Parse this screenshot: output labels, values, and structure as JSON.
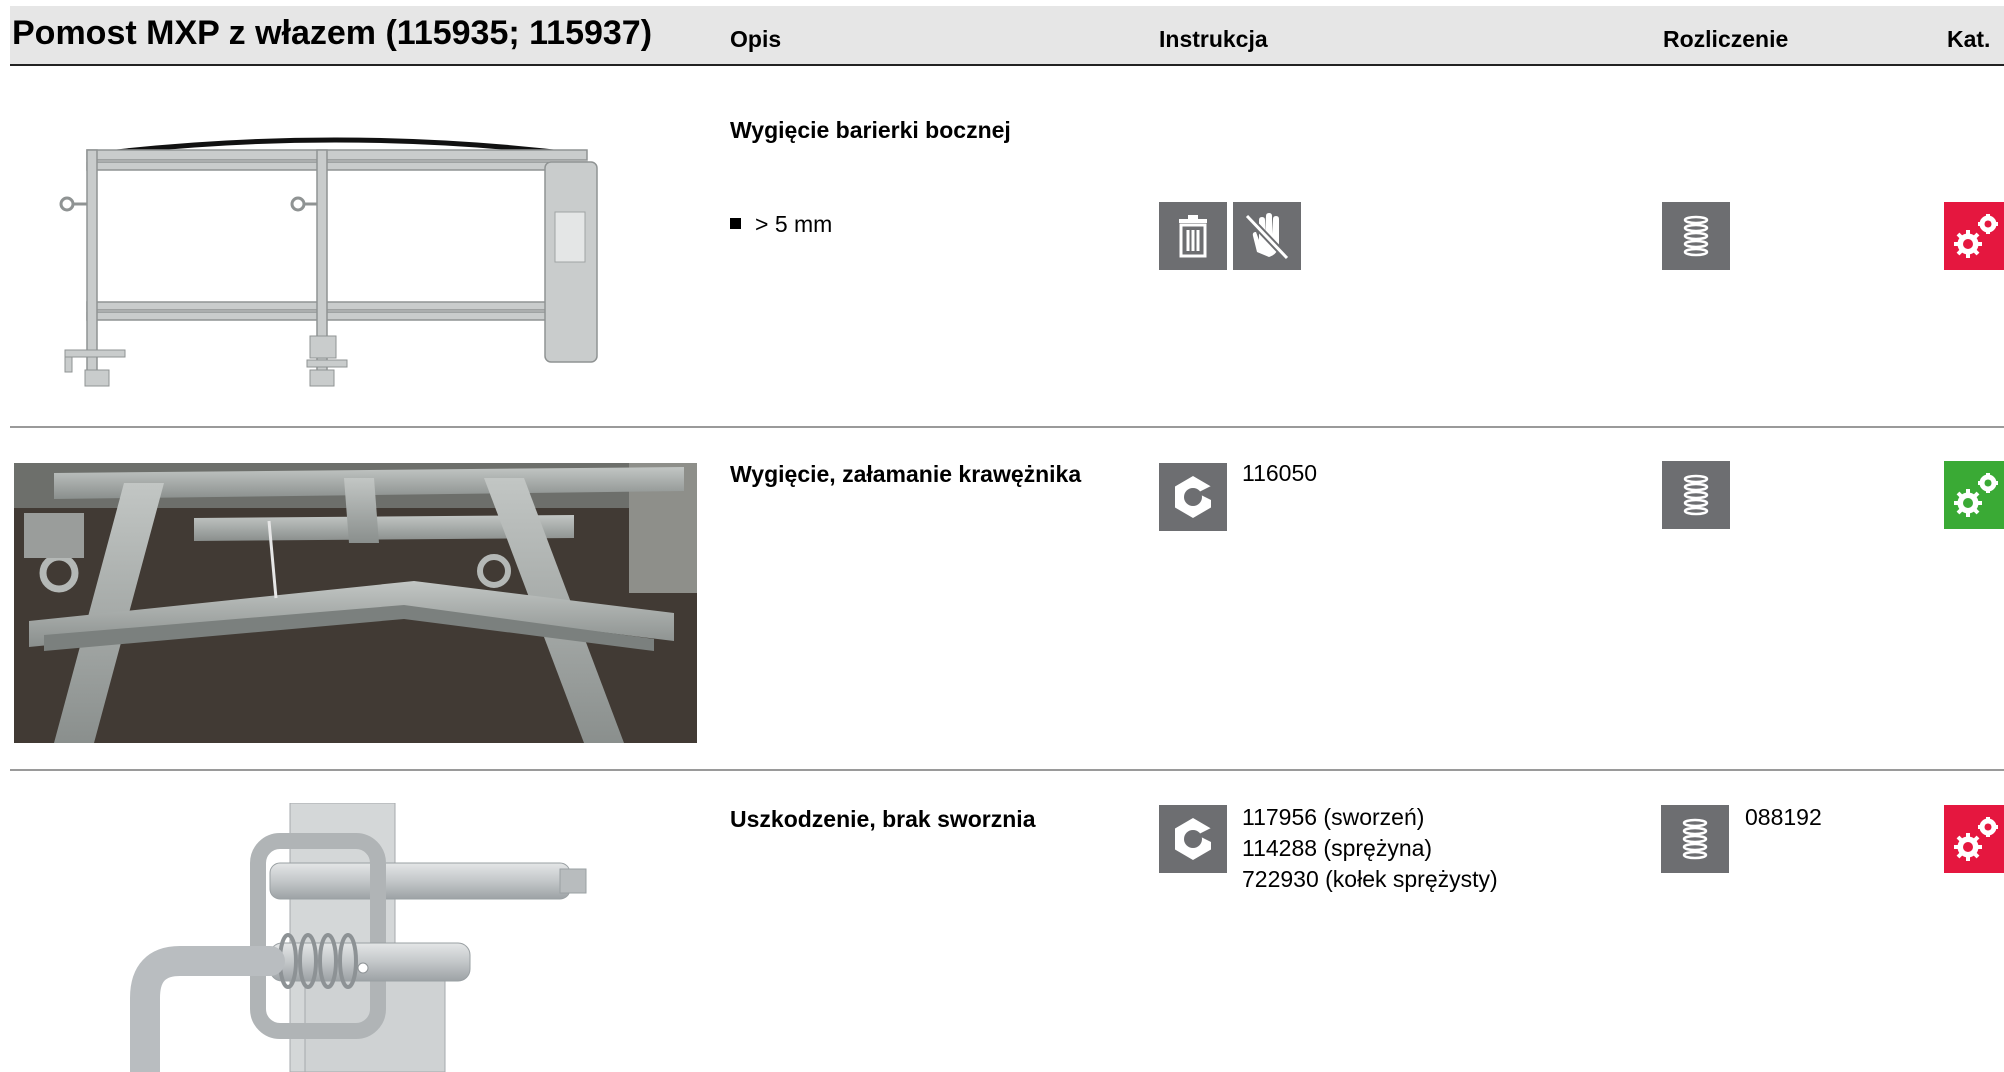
{
  "header": {
    "title": "Pomost MXP z włazem (115935; 115937)",
    "col_opis": "Opis",
    "col_instrukcja": "Instrukcja",
    "col_rozliczenie": "Rozliczenie",
    "col_kat": "Kat."
  },
  "rows": [
    {
      "description": "Wygięcie barierki bocznej",
      "bullet": "> 5 mm",
      "instruction_icons": [
        "trash-icon",
        "no-touch-icon"
      ],
      "settlement_icon": "stack-icon",
      "category_color": "#e5173f",
      "image": "side-railing-drawing"
    },
    {
      "description": "Wygięcie, załamanie krawężnika",
      "instruction_icons": [
        "nut-icon"
      ],
      "instruction_refs": [
        "116050"
      ],
      "settlement_icon": "stack-icon",
      "category_color": "#3aaa35",
      "image": "kerb-photo"
    },
    {
      "description": "Uszkodzenie, brak sworznia",
      "instruction_icons": [
        "nut-icon"
      ],
      "instruction_refs": [
        "117956 (sworzeń)",
        "114288 (sprężyna)",
        "722930 (kołek sprężysty)"
      ],
      "settlement_icon": "stack-icon",
      "settlement_refs": [
        "088192"
      ],
      "category_color": "#e5173f",
      "image": "pin-drawing"
    }
  ]
}
